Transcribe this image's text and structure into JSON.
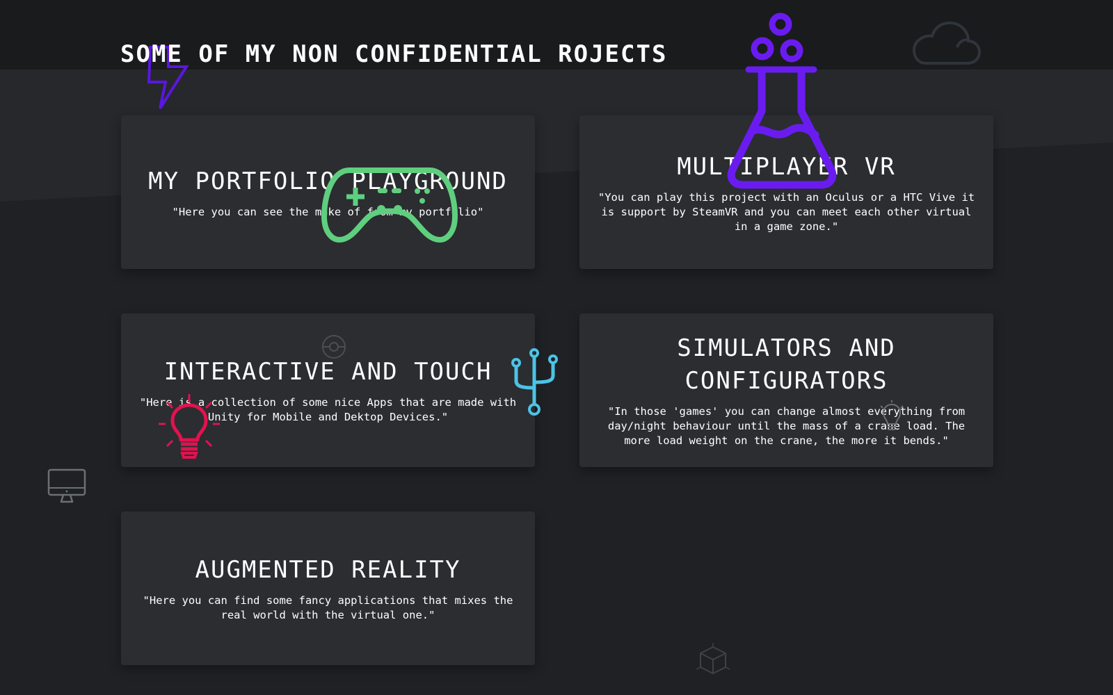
{
  "page": {
    "title": "SOME OF MY NON CONFIDENTIAL ROJECTS"
  },
  "colors": {
    "background": "#1f2125",
    "header_band": "#1a1b1d",
    "card": "#2b2d31",
    "gamepad": "#5fcf7f",
    "flask": "#6a1cf0",
    "bolt": "#5a16e0",
    "usb": "#4cc3e6",
    "bulb": "#e0134f",
    "muted_icon": "#4a4f55"
  },
  "projects": [
    {
      "title": "MY PORTFOLIO PLAYGROUND",
      "description": "\"Here you can see the make of from my portfolio\""
    },
    {
      "title": "MULTIPLAYER VR",
      "description": "\"You can play this project with an Oculus or a HTC Vive it is support by SteamVR and you can meet each other virtual in a game zone.\""
    },
    {
      "title": "INTERACTIVE AND TOUCH",
      "description": "\"Here is a collection of some nice Apps that are made with Unity for Mobile and Dektop Devices.\""
    },
    {
      "title": "SIMULATORS AND CONFIGURATORS",
      "description": "\"In those 'games' you can change almost everything from day/night behaviour until the mass of a crane load. The more load weight on the crane, the more it bends.\""
    },
    {
      "title": "AUGMENTED REALITY",
      "description": "\"Here you can find some fancy applications that mixes the real world with the virtual one.\""
    }
  ],
  "decorations": [
    "cloud-icon",
    "lightning-bolt-icon",
    "flask-icon",
    "gamepad-icon",
    "target-icon",
    "usb-icon",
    "lightbulb-icon",
    "monitor-icon",
    "cube-icon"
  ]
}
